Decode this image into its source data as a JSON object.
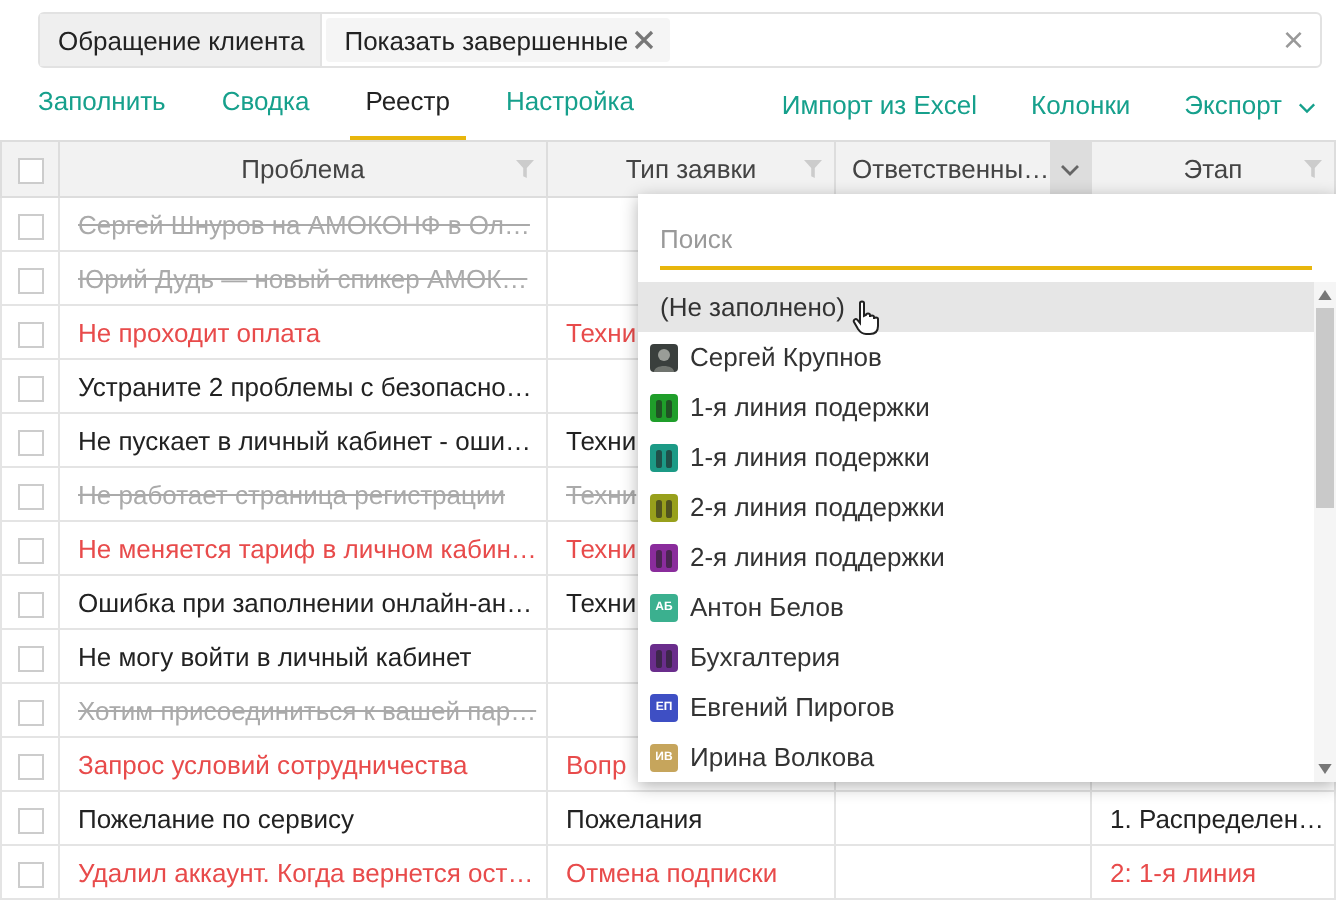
{
  "filter_bar": {
    "chips": [
      {
        "label": "Обращение клиента",
        "removable": false
      },
      {
        "label": "Показать завершенные",
        "removable": true
      }
    ],
    "clear": "×"
  },
  "tabs": [
    {
      "label": "Заполнить",
      "selected": false
    },
    {
      "label": "Сводка",
      "selected": false
    },
    {
      "label": "Реестр",
      "selected": true
    },
    {
      "label": "Настройка",
      "selected": false
    }
  ],
  "actions": [
    {
      "label": "Импорт из Excel",
      "dropdown": false
    },
    {
      "label": "Колонки",
      "dropdown": false
    },
    {
      "label": "Экспорт",
      "dropdown": true
    }
  ],
  "table": {
    "all_checked": false,
    "columns": [
      {
        "label": "Проблема",
        "menu_open": false
      },
      {
        "label": "Тип заявки",
        "menu_open": false
      },
      {
        "label": "Ответственны…",
        "menu_open": true
      },
      {
        "label": "Этап",
        "menu_open": false
      }
    ],
    "rows": [
      {
        "checked": false,
        "completed": true,
        "overdue": false,
        "cells": [
          "Сергей Шнуров на АМОКОНФ в Ол…",
          "",
          "",
          ""
        ]
      },
      {
        "checked": false,
        "completed": true,
        "overdue": false,
        "cells": [
          "Юрий Дудь — новый спикер АМОК…",
          "",
          "",
          ""
        ]
      },
      {
        "checked": false,
        "completed": false,
        "overdue": true,
        "cells": [
          "Не проходит оплата",
          "Техни",
          "",
          ""
        ]
      },
      {
        "checked": false,
        "completed": false,
        "overdue": false,
        "cells": [
          "Устраните 2 проблемы с безопасно…",
          "",
          "",
          ""
        ]
      },
      {
        "checked": false,
        "completed": false,
        "overdue": false,
        "cells": [
          "Не пускает в личный кабинет - оши…",
          "Техни",
          "",
          ""
        ]
      },
      {
        "checked": false,
        "completed": true,
        "overdue": false,
        "cells": [
          "Не работает страница регистрации",
          "Техни",
          "",
          ""
        ]
      },
      {
        "checked": false,
        "completed": false,
        "overdue": true,
        "cells": [
          "Не меняется тариф в личном кабин…",
          "Техни",
          "",
          ""
        ]
      },
      {
        "checked": false,
        "completed": false,
        "overdue": false,
        "cells": [
          "Ошибка при заполнении онлайн-ан…",
          "Техни",
          "",
          ""
        ]
      },
      {
        "checked": false,
        "completed": false,
        "overdue": false,
        "cells": [
          "Не могу войти в личный кабинет",
          "",
          "",
          ""
        ]
      },
      {
        "checked": false,
        "completed": true,
        "overdue": false,
        "cells": [
          "Хотим присоединиться к вашей пар…",
          "",
          "",
          ""
        ]
      },
      {
        "checked": false,
        "completed": false,
        "overdue": true,
        "cells": [
          "Запрос условий сотрудничества",
          "Вопр",
          "",
          ""
        ]
      },
      {
        "checked": false,
        "completed": false,
        "overdue": false,
        "cells": [
          "Пожелание по сервису",
          "Пожелания",
          "",
          "1. Распределен…"
        ]
      },
      {
        "checked": false,
        "completed": false,
        "overdue": true,
        "cells": [
          "Удалил аккаунт. Когда вернется ост…",
          "Отмена подписки",
          "",
          "2: 1-я линия"
        ]
      }
    ]
  },
  "dropdown": {
    "search": {
      "placeholder": "Поиск"
    },
    "options": [
      {
        "label": "(Не заполнено)",
        "kind": "none",
        "hovered": true
      },
      {
        "label": "Сергей Крупнов",
        "kind": "photo",
        "hovered": false
      },
      {
        "label": "1-я линия подержки",
        "kind": "group",
        "color": "#1f9e2a",
        "hovered": false
      },
      {
        "label": "1-я линия подержки",
        "kind": "group",
        "color": "#1c9a86",
        "hovered": false
      },
      {
        "label": "2-я линия поддержки",
        "kind": "group",
        "color": "#98a01c",
        "hovered": false
      },
      {
        "label": "2-я линия поддержки",
        "kind": "group",
        "color": "#8a2c9c",
        "hovered": false
      },
      {
        "label": "Антон Белов",
        "kind": "initials",
        "initials": "АБ",
        "color": "#3bb08f",
        "hovered": false
      },
      {
        "label": "Бухгалтерия",
        "kind": "group",
        "color": "#6a2d8c",
        "hovered": false
      },
      {
        "label": "Евгений Пирогов",
        "kind": "initials",
        "initials": "ЕП",
        "color": "#3e4fc4",
        "hovered": false
      },
      {
        "label": "Ирина Волкова",
        "kind": "initials",
        "initials": "ИВ",
        "color": "#c6a55c",
        "hovered": false
      }
    ]
  }
}
